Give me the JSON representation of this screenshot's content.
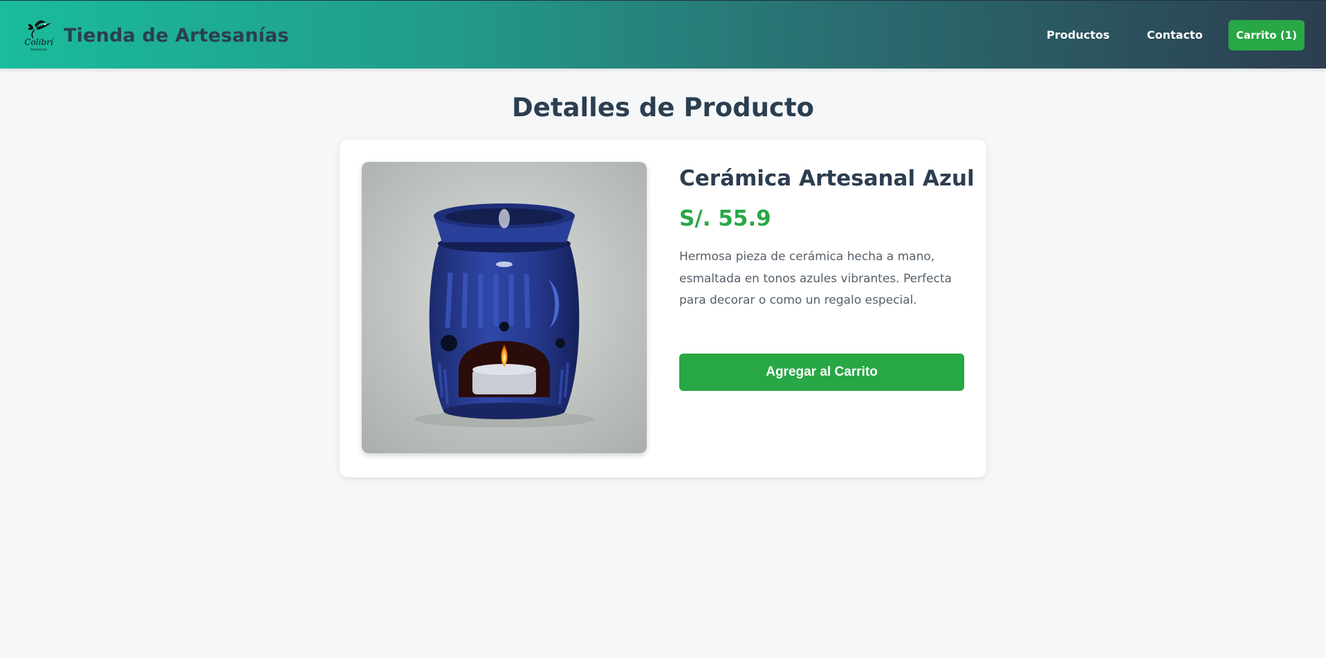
{
  "header": {
    "brand_title": "Tienda de Artesanías",
    "logo_icon": "hummingbird-logo-icon",
    "nav": [
      "Productos",
      "Contacto"
    ],
    "cart_label": "Carrito (1)"
  },
  "page": {
    "title": "Detalles de Producto"
  },
  "product": {
    "name": "Cerámica Artesanal Azul",
    "price": "S/. 55.9",
    "description": "Hermosa pieza de cerámica hecha a mano, esmaltada en tonos azules vibrantes. Perfecta para decorar o como un regalo especial.",
    "add_to_cart_label": "Agregar al Carrito",
    "image_icon": "ceramic-oil-burner-image"
  },
  "colors": {
    "accent_green": "#28a745",
    "heading": "#2c3e50",
    "header_gradient_start": "#1abc9c",
    "header_gradient_end": "#2c3e50",
    "background": "#f6f7f9"
  }
}
